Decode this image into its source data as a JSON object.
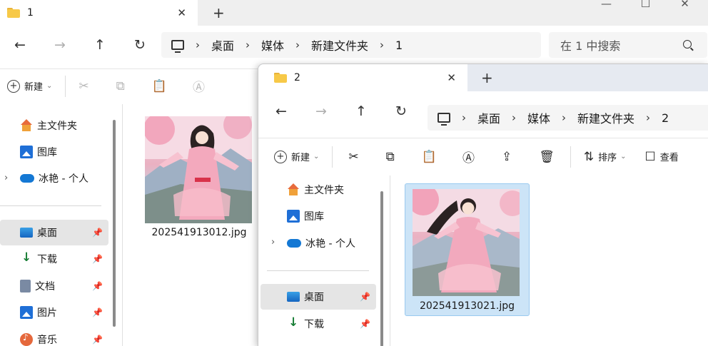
{
  "window1": {
    "tab_title": "1",
    "tab_close": "✕",
    "new_tab": "+",
    "controls": {
      "minimize": "—",
      "maximize": "☐",
      "close": "✕"
    },
    "nav": {
      "back": "←",
      "forward": "→",
      "up": "↑",
      "refresh": "↻"
    },
    "breadcrumb": [
      "桌面",
      "媒体",
      "新建文件夹",
      "1"
    ],
    "breadcrumb_sep": "›",
    "search_placeholder": "在 1 中搜索",
    "toolbar": {
      "new_label": "新建",
      "caret": "⌄"
    },
    "sidebar": [
      {
        "label": "主文件夹",
        "icon": "home-icon",
        "pinned": false
      },
      {
        "label": "图库",
        "icon": "gallery-icon",
        "pinned": false
      },
      {
        "label": "冰艳 - 个人",
        "icon": "cloud-icon",
        "pinned": false
      },
      {
        "label": "桌面",
        "icon": "desktop-icon",
        "pinned": true
      },
      {
        "label": "下载",
        "icon": "download-icon",
        "pinned": true
      },
      {
        "label": "文档",
        "icon": "documents-icon",
        "pinned": true
      },
      {
        "label": "图片",
        "icon": "pictures-icon",
        "pinned": true
      },
      {
        "label": "音乐",
        "icon": "music-icon",
        "pinned": true
      }
    ],
    "files": [
      {
        "name": "202541913012.jpg"
      }
    ]
  },
  "window2": {
    "tab_title": "2",
    "tab_close": "✕",
    "new_tab": "+",
    "nav": {
      "back": "←",
      "forward": "→",
      "up": "↑",
      "refresh": "↻"
    },
    "breadcrumb": [
      "桌面",
      "媒体",
      "新建文件夹",
      "2"
    ],
    "breadcrumb_sep": "›",
    "toolbar": {
      "new_label": "新建",
      "sort_label": "排序",
      "view_label": "查看",
      "caret": "⌄"
    },
    "sidebar": [
      {
        "label": "主文件夹",
        "icon": "home-icon",
        "pinned": false
      },
      {
        "label": "图库",
        "icon": "gallery-icon",
        "pinned": false
      },
      {
        "label": "冰艳 - 个人",
        "icon": "cloud-icon",
        "pinned": false
      },
      {
        "label": "桌面",
        "icon": "desktop-icon",
        "pinned": true
      },
      {
        "label": "下载",
        "icon": "download-icon",
        "pinned": true
      }
    ],
    "files": [
      {
        "name": "202541913021.jpg",
        "selected": true
      }
    ]
  },
  "colors": {
    "accent": "#0067c0",
    "selection": "#cce4f7",
    "folder": "#f7c948"
  }
}
